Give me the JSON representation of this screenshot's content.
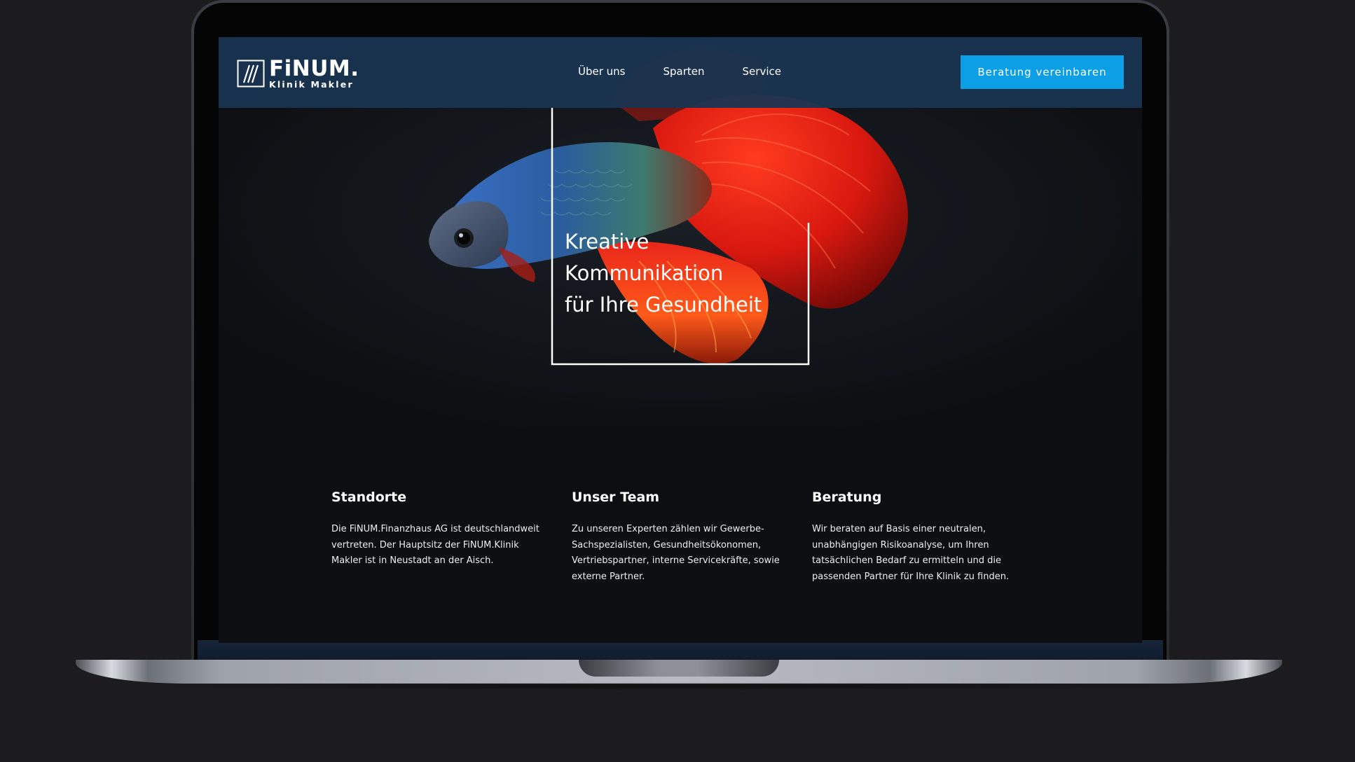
{
  "brand": {
    "name": "FiNUM.",
    "subtitle": "Klinik Makler"
  },
  "nav": {
    "items": [
      {
        "label": "Über uns"
      },
      {
        "label": "Sparten"
      },
      {
        "label": "Service"
      }
    ],
    "cta_label": "Beratung vereinbaren"
  },
  "hero": {
    "lines": [
      "Kreative",
      "Kommunikation",
      "für Ihre Gesundheit"
    ]
  },
  "features": [
    {
      "title": "Standorte",
      "text": "Die FiNUM.Finanzhaus AG ist deutschlandweit vertreten. Der Hauptsitz der FiNUM.Klinik Makler ist in Neustadt an der Aisch."
    },
    {
      "title": "Unser Team",
      "text": "Zu unseren Experten zählen wir Gewerbe-Sachspezialisten, Gesundheitsökonomen, Vertriebspartner, interne Servicekräfte, sowie externe Partner."
    },
    {
      "title": "Beratung",
      "text": "Wir beraten auf Basis einer neutralen, unabhängigen Risikoanalyse, um Ihren tatsächlichen Bedarf zu ermitteln und die passenden Partner für Ihre Klinik zu finden."
    }
  ],
  "colors": {
    "header_bg": "#193452",
    "cta_bg": "#0c9fe6",
    "page_bg": "#0c0e11",
    "fish_red": "#e8261a",
    "fish_blue": "#2a66c8"
  },
  "icons": {
    "logo": "finum-logo-icon"
  }
}
